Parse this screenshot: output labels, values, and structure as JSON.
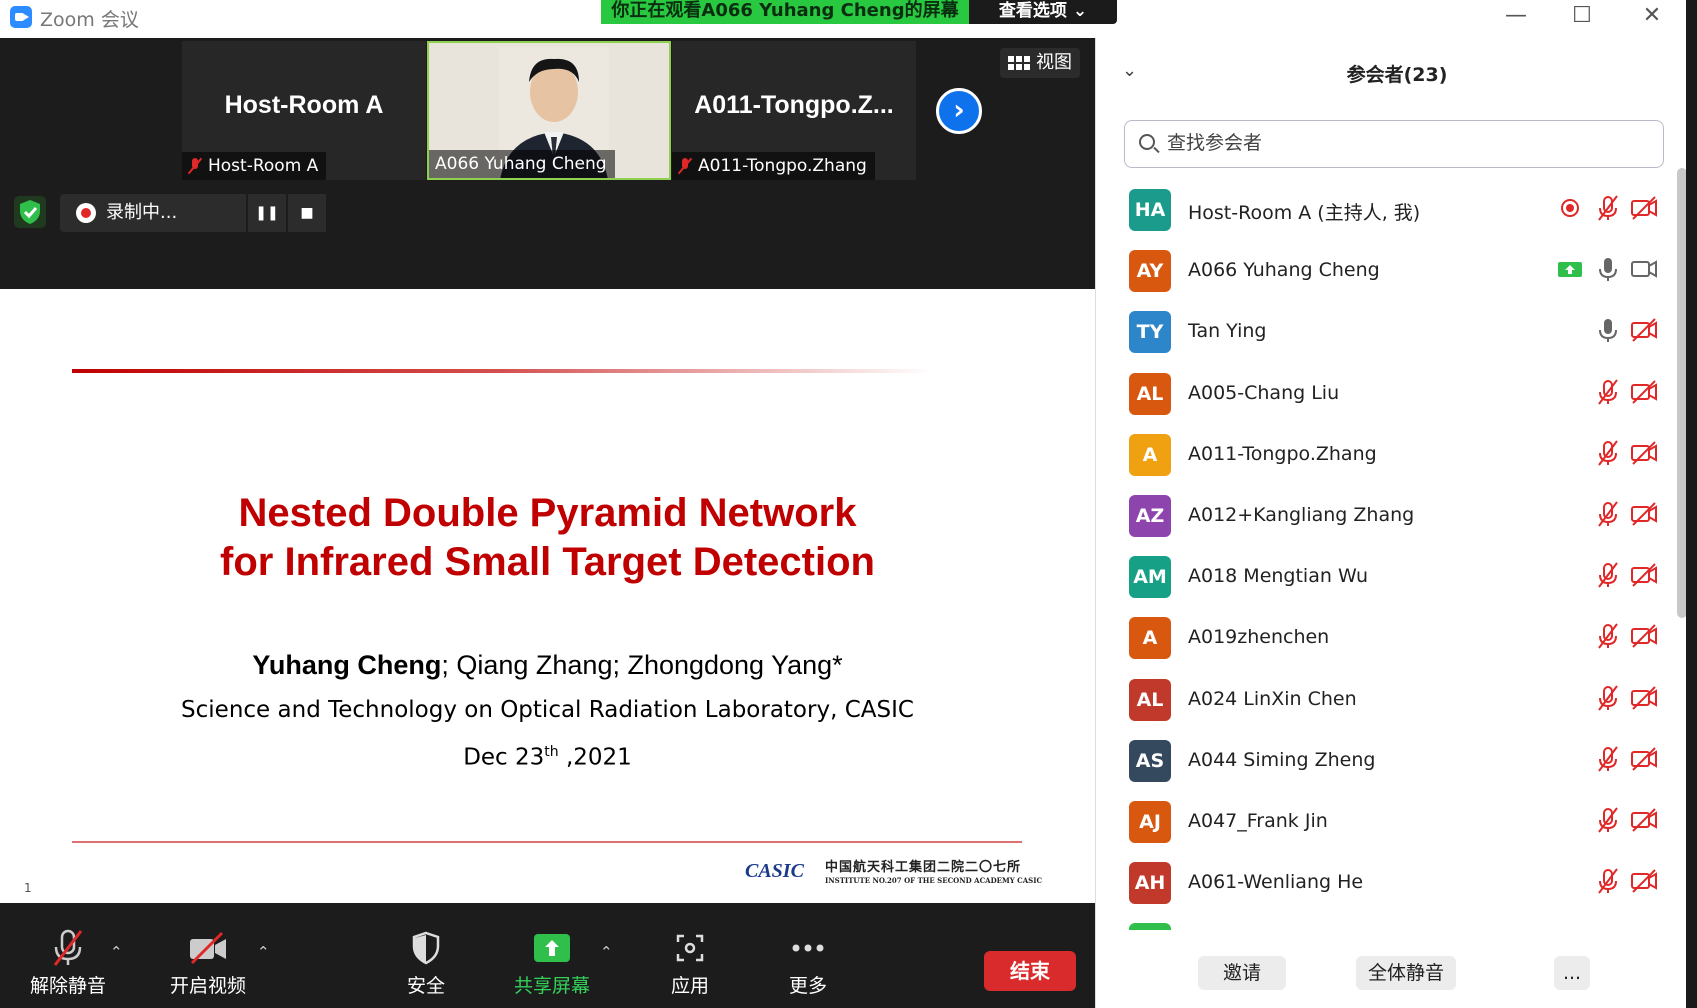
{
  "titlebar": {
    "app_title": "Zoom 会议",
    "share_banner": "你正在观看A066 Yuhang Cheng的屏幕",
    "view_options": "查看选项 ⌄",
    "minimize": "—",
    "maximize": "☐",
    "close": "✕"
  },
  "video_strip": {
    "tiles": [
      {
        "big_name": "Host-Room A",
        "label": "Host-Room A",
        "muted": true
      },
      {
        "big_name": "",
        "label": "A066 Yuhang Cheng",
        "muted": false
      },
      {
        "big_name": "A011-Tongpo.Z...",
        "label": "A011-Tongpo.Zhang",
        "muted": true
      }
    ],
    "next_arrow": "›",
    "view_button": "视图",
    "recording": {
      "status": "录制中...",
      "pause": "❚❚",
      "stop": "■"
    }
  },
  "slide": {
    "title_line1": "Nested Double Pyramid Network",
    "title_line2": "for Infrared Small Target Detection",
    "author_bold": "Yuhang Cheng",
    "authors_rest": "; Qiang Zhang; Zhongdong Yang*",
    "lab": "Science and Technology on Optical Radiation Laboratory, CASIC",
    "date_prefix": "Dec 23",
    "date_sup": "th",
    "date_suffix": " ,2021",
    "logo_mark": "CASIC",
    "logo_cn": "中国航天科工集团二院二〇七所",
    "logo_en": "INSTITUTE NO.207 OF THE SECOND ACADEMY CASIC",
    "page_number": "1"
  },
  "toolbar": {
    "unmute": "解除静音",
    "start_video": "开启视频",
    "security": "安全",
    "share_screen": "共享屏幕",
    "apps": "应用",
    "more": "更多",
    "end": "结束",
    "caret": "⌃"
  },
  "panel": {
    "collapse": "⌄",
    "title": "参会者(23)",
    "search_placeholder": "查找参会者",
    "participants": [
      {
        "initials": "HA",
        "name": "Host-Room A (主持人, 我)",
        "color": "#1a9b8c",
        "recording": true,
        "share": false,
        "mic": "muted",
        "video": "off"
      },
      {
        "initials": "AY",
        "name": "A066 Yuhang Cheng",
        "color": "#d9580f",
        "recording": false,
        "share": true,
        "mic": "on",
        "video": "on"
      },
      {
        "initials": "TY",
        "name": "Tan Ying",
        "color": "#2c86c9",
        "recording": false,
        "share": false,
        "mic": "on",
        "video": "off"
      },
      {
        "initials": "AL",
        "name": "A005-Chang Liu",
        "color": "#d9580f",
        "recording": false,
        "share": false,
        "mic": "muted",
        "video": "off"
      },
      {
        "initials": "A",
        "name": "A011-Tongpo.Zhang",
        "color": "#f0a112",
        "recording": false,
        "share": false,
        "mic": "muted",
        "video": "off"
      },
      {
        "initials": "AZ",
        "name": "A012+Kangliang Zhang",
        "color": "#8e44ad",
        "recording": false,
        "share": false,
        "mic": "muted",
        "video": "off"
      },
      {
        "initials": "AM",
        "name": "A018 Mengtian Wu",
        "color": "#16a085",
        "recording": false,
        "share": false,
        "mic": "muted",
        "video": "off"
      },
      {
        "initials": "A",
        "name": "A019zhenchen",
        "color": "#d9580f",
        "recording": false,
        "share": false,
        "mic": "muted",
        "video": "off"
      },
      {
        "initials": "AL",
        "name": "A024 LinXin Chen",
        "color": "#c0392b",
        "recording": false,
        "share": false,
        "mic": "muted",
        "video": "off"
      },
      {
        "initials": "AS",
        "name": "A044 Siming Zheng",
        "color": "#34495e",
        "recording": false,
        "share": false,
        "mic": "muted",
        "video": "off"
      },
      {
        "initials": "AJ",
        "name": "A047_Frank Jin",
        "color": "#d9580f",
        "recording": false,
        "share": false,
        "mic": "muted",
        "video": "off"
      },
      {
        "initials": "AH",
        "name": "A061-Wenliang He",
        "color": "#c0392b",
        "recording": false,
        "share": false,
        "mic": "muted",
        "video": "off"
      }
    ],
    "invite": "邀请",
    "mute_all": "全体静音",
    "more": "..."
  }
}
